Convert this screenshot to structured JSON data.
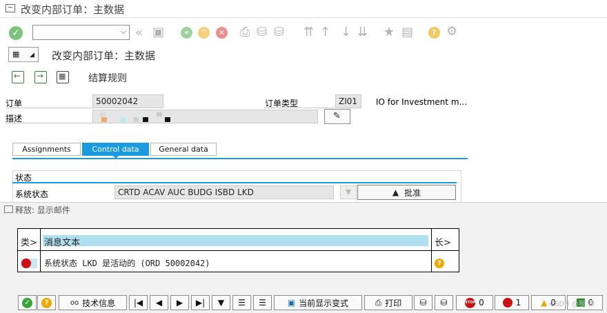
{
  "window": {
    "title": "改变内部订单：主数据"
  },
  "toolbar": {
    "command_value": ""
  },
  "page": {
    "title": "改变内部订单：主数据"
  },
  "app_toolbar": {
    "settlement_rule": "结算规则"
  },
  "fields": {
    "order_label": "订单",
    "order_value": "50002042",
    "order_type_label": "订单类型",
    "order_type_value": "ZI01",
    "order_type_desc": "IO for Investment m...",
    "desc_label": "描述",
    "desc_value": ""
  },
  "tabs": [
    {
      "label": "Assignments",
      "active": false
    },
    {
      "label": "Control data",
      "active": true
    },
    {
      "label": "General data",
      "active": false
    }
  ],
  "status": {
    "group_title": "状态",
    "system_status_label": "系统状态",
    "system_status_value": "CRTD ACAV AUC  BUDG ISBD LKD",
    "approve_label": "批准"
  },
  "popup": {
    "title": "释放: 显示邮件",
    "headers": {
      "type": "类>",
      "text": "消息文本",
      "length": "长>"
    },
    "rows": [
      {
        "type": "error",
        "text": "系统状态 LKD 是活动的 (ORD 50002042)"
      }
    ]
  },
  "bottom_toolbar": {
    "tech_info": "技术信息",
    "current_layout": "当前显示变式",
    "print": "打印",
    "stop_count": "0",
    "error_count": "1",
    "warning_count": "0",
    "info_count": "0",
    "watermark": "CSDN @猴 帅"
  },
  "colors": {
    "accent": "#1a9be0",
    "header_highlight": "#aee0f0",
    "error_red": "#cc1111",
    "ok_green": "#5cb85c",
    "help_orange": "#f0a800"
  }
}
